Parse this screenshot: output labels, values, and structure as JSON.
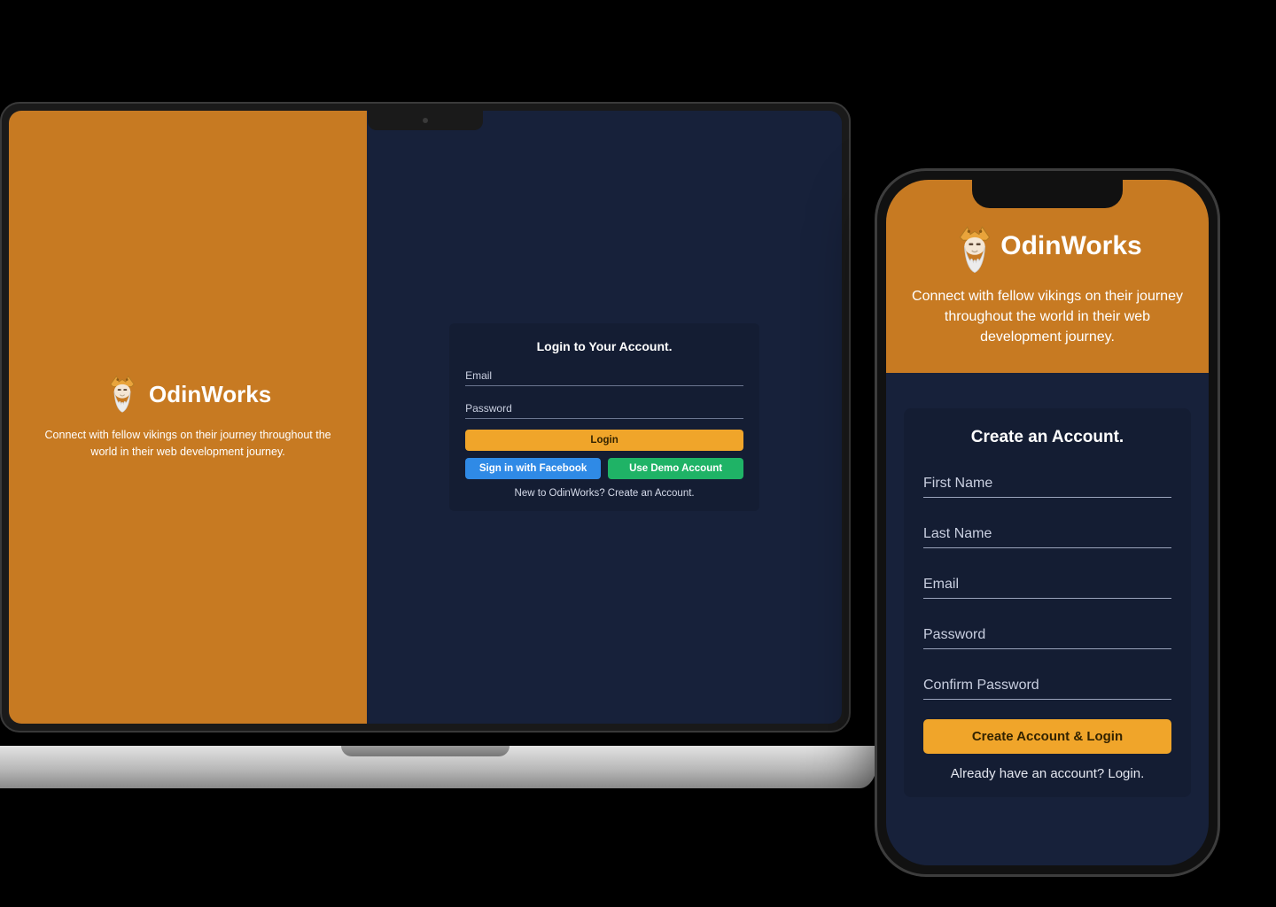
{
  "brand": {
    "name": "OdinWorks"
  },
  "tagline": "Connect with fellow vikings on their journey throughout the world in their web development journey.",
  "login": {
    "heading": "Login to Your Account.",
    "email_ph": "Email",
    "password_ph": "Password",
    "login_btn": "Login",
    "facebook_btn": "Sign in with Facebook",
    "demo_btn": "Use Demo Account",
    "switch_text": "New to OdinWorks? Create an Account."
  },
  "signup": {
    "heading": "Create an Account.",
    "first_ph": "First Name",
    "last_ph": "Last Name",
    "email_ph": "Email",
    "password_ph": "Password",
    "confirm_ph": "Confirm Password",
    "submit_btn": "Create Account & Login",
    "switch_text": "Already have an account? Login."
  },
  "colors": {
    "accent": "#c77a22",
    "panel": "#17213a",
    "card": "#141d33",
    "primary_btn": "#f0a52a",
    "facebook_btn": "#2f8ae6",
    "demo_btn": "#1fb366"
  }
}
